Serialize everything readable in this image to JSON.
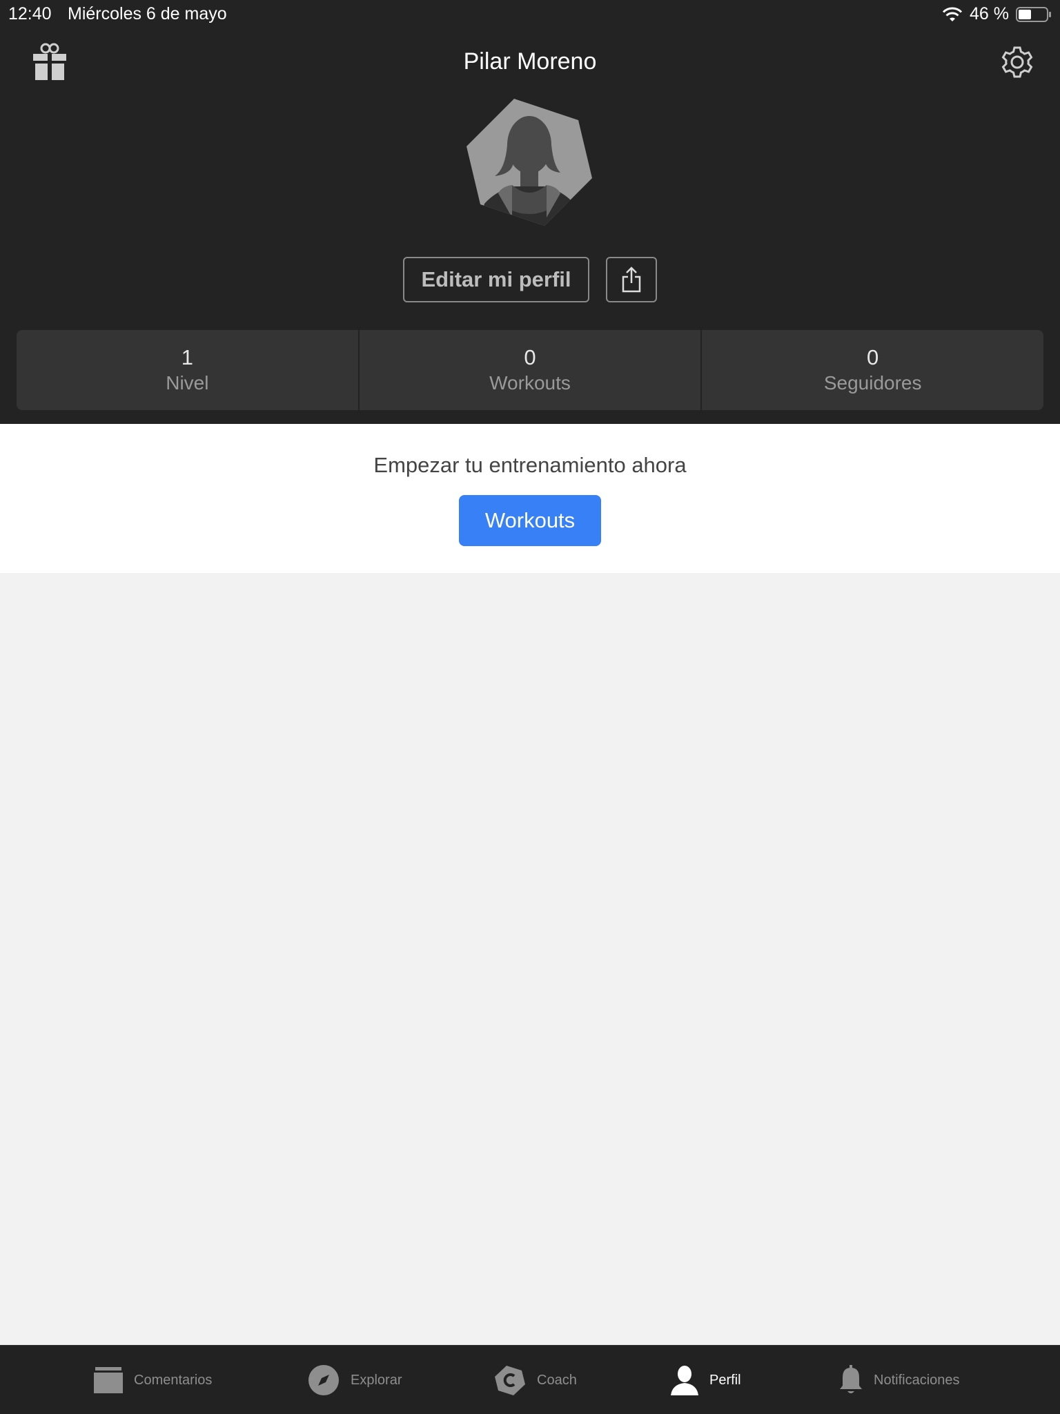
{
  "status_bar": {
    "time": "12:40",
    "date": "Miércoles 6 de mayo",
    "battery": "46 %"
  },
  "header": {
    "title": "Pilar Moreno",
    "left_icon": "gift-icon",
    "right_icon": "gear-icon"
  },
  "profile_actions": {
    "edit_label": "Editar mi perfil",
    "share_icon": "share-icon"
  },
  "stats": [
    {
      "value": "1",
      "label": "Nivel"
    },
    {
      "value": "0",
      "label": "Workouts"
    },
    {
      "value": "0",
      "label": "Seguidores"
    }
  ],
  "cta": {
    "text": "Empezar tu entrenamiento ahora",
    "button_label": "Workouts"
  },
  "tabbar": {
    "items": [
      {
        "label": "Comentarios",
        "icon": "feed-icon"
      },
      {
        "label": "Explorar",
        "icon": "compass-icon"
      },
      {
        "label": "Coach",
        "icon": "coach-icon"
      },
      {
        "label": "Perfil",
        "icon": "profile-icon",
        "active": true
      },
      {
        "label": "Notificaciones",
        "icon": "bell-icon"
      }
    ]
  },
  "colors": {
    "header_bg": "#232323",
    "accent": "#3880f5",
    "page_bg": "#f2f2f2"
  }
}
